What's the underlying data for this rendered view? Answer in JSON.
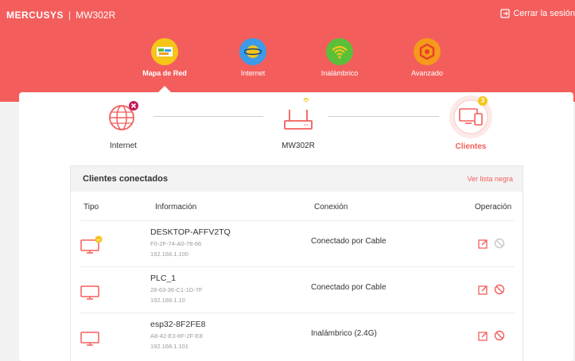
{
  "header": {
    "brand": "MERCUSYS",
    "separator": "|",
    "model": "MW302R",
    "logout_label": "Cerrar la sesión"
  },
  "nav": [
    {
      "label": "Mapa de Red",
      "icon": "network-map-icon",
      "active": true,
      "color": "#f5c518"
    },
    {
      "label": "Internet",
      "icon": "globe-icon",
      "active": false,
      "color": "#3b9be8"
    },
    {
      "label": "Inalámbrico",
      "icon": "wifi-icon",
      "active": false,
      "color": "#5cbf3a"
    },
    {
      "label": "Avanzado",
      "icon": "gear-icon",
      "active": false,
      "color": "#f59a1a"
    }
  ],
  "topology": {
    "internet_label": "Internet",
    "router_label": "MW302R",
    "clients_label": "Clientes",
    "clients_count": "3"
  },
  "clients": {
    "title": "Clientes conectados",
    "blacklist_link": "Ver lista negra",
    "columns": [
      "Tipo",
      "Información",
      "Conexión",
      "Operación"
    ],
    "rows": [
      {
        "name": "DESKTOP-AFFV2TQ",
        "mac": "F0-2F-74-A0-78-66",
        "ip": "192.168.1.100",
        "connection": "Conectado por Cable",
        "badge": true
      },
      {
        "name": "PLC_1",
        "mac": "28-63-36-C1-1D-7F",
        "ip": "192.168.1.10",
        "connection": "Conectado por Cable",
        "badge": false
      },
      {
        "name": "esp32-8F2FE8",
        "mac": "A8-42-E3-8F-2F-E8",
        "ip": "192.168.1.101",
        "connection": "Inalámbrico (2.4G)",
        "badge": false
      }
    ]
  },
  "colors": {
    "brand_red": "#f35e5c",
    "accent_yellow": "#f5c518"
  }
}
